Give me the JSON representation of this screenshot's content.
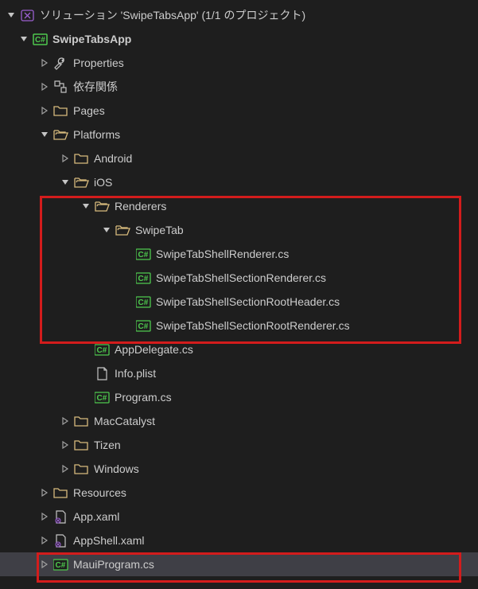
{
  "solution": {
    "label": "ソリューション 'SwipeTabsApp' (1/1 のプロジェクト)"
  },
  "project": {
    "label": "SwipeTabsApp"
  },
  "nodes": {
    "properties": "Properties",
    "deps": "依存関係",
    "pages": "Pages",
    "platforms": "Platforms",
    "android": "Android",
    "ios": "iOS",
    "renderers": "Renderers",
    "swipetab": "SwipeTab",
    "f1": "SwipeTabShellRenderer.cs",
    "f2": "SwipeTabShellSectionRenderer.cs",
    "f3": "SwipeTabShellSectionRootHeader.cs",
    "f4": "SwipeTabShellSectionRootRenderer.cs",
    "appdelegate": "AppDelegate.cs",
    "infoplist": "Info.plist",
    "programcs": "Program.cs",
    "maccatalyst": "MacCatalyst",
    "tizen": "Tizen",
    "windows": "Windows",
    "resources": "Resources",
    "appxaml": "App.xaml",
    "appshell": "AppShell.xaml",
    "mauiprogram": "MauiProgram.cs"
  },
  "icons": {
    "cs_badge": "C#"
  }
}
